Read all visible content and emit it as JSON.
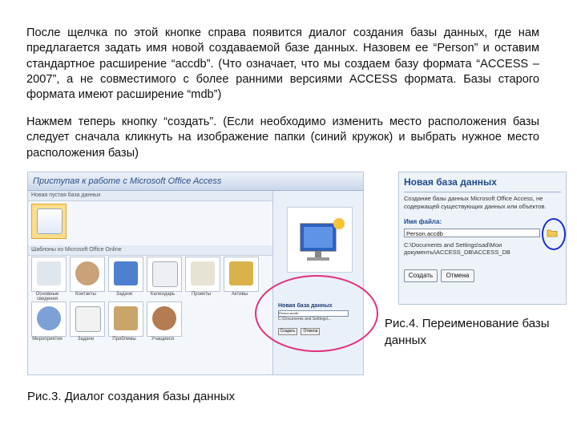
{
  "text": {
    "paragraph1": "После щелчка по этой кнопке справа появится диалог создания базы данных, где нам предлагается задать имя новой создаваемой базе данных. Назовем ее “Person” и оставим стандартное расширение “accdb”. (Что означает, что мы создаем базу формата “ACCESS – 2007”, а не совместимого с более ранними версиями ACCESS формата. Базы старого формата имеют расширение “mdb”)",
    "paragraph2": "Нажмем теперь кнопку “создать”. (Если необходимо изменить место расположения базы следует сначала кликнуть на изображение папки (синий кружок) и выбрать нужное место расположения базы)",
    "caption_fig4": "Рис.4. Переименование базы данных",
    "caption_fig3": "Рис.3. Диалог создания базы данных"
  },
  "fig3": {
    "title": "Приступая к работе с Microsoft Office Access",
    "section_new": "Новая пустая база данных",
    "section_templates": "Шаблоны из Microsoft Office Online",
    "tiles_row1": [
      "Основные сведения",
      "Контакты",
      "Задачи",
      "Календарь",
      "Проекты",
      "Активы"
    ],
    "tiles_row2": [
      "Мероприятия",
      "Задачи",
      "Проблемы",
      "Учащиеся"
    ],
    "dialog_title": "Новая база данных",
    "dialog_file": "Person.accdb",
    "dialog_path": "C:\\Documents and Settings\\...",
    "btn_create": "Создать",
    "btn_cancel": "Отмена",
    "icon": "database-computer-icon"
  },
  "fig4": {
    "title": "Новая база данных",
    "description": "Создание базы данных Microsoft Office Access, не содержащей существующих данных или объектов.",
    "file_label": "Имя файла:",
    "file_value": "Person.accdb",
    "path": "C:\\Documents and Settings\\sad\\Мои документы\\ACCESS_DB\\ACCESS_DB",
    "btn_create": "Создать",
    "btn_cancel": "Отмена",
    "folder_icon": "folder-icon"
  },
  "colors": {
    "highlight_pink": "#e0307f",
    "highlight_blue": "#1c2fd0",
    "accent": "#1e4a8a"
  }
}
